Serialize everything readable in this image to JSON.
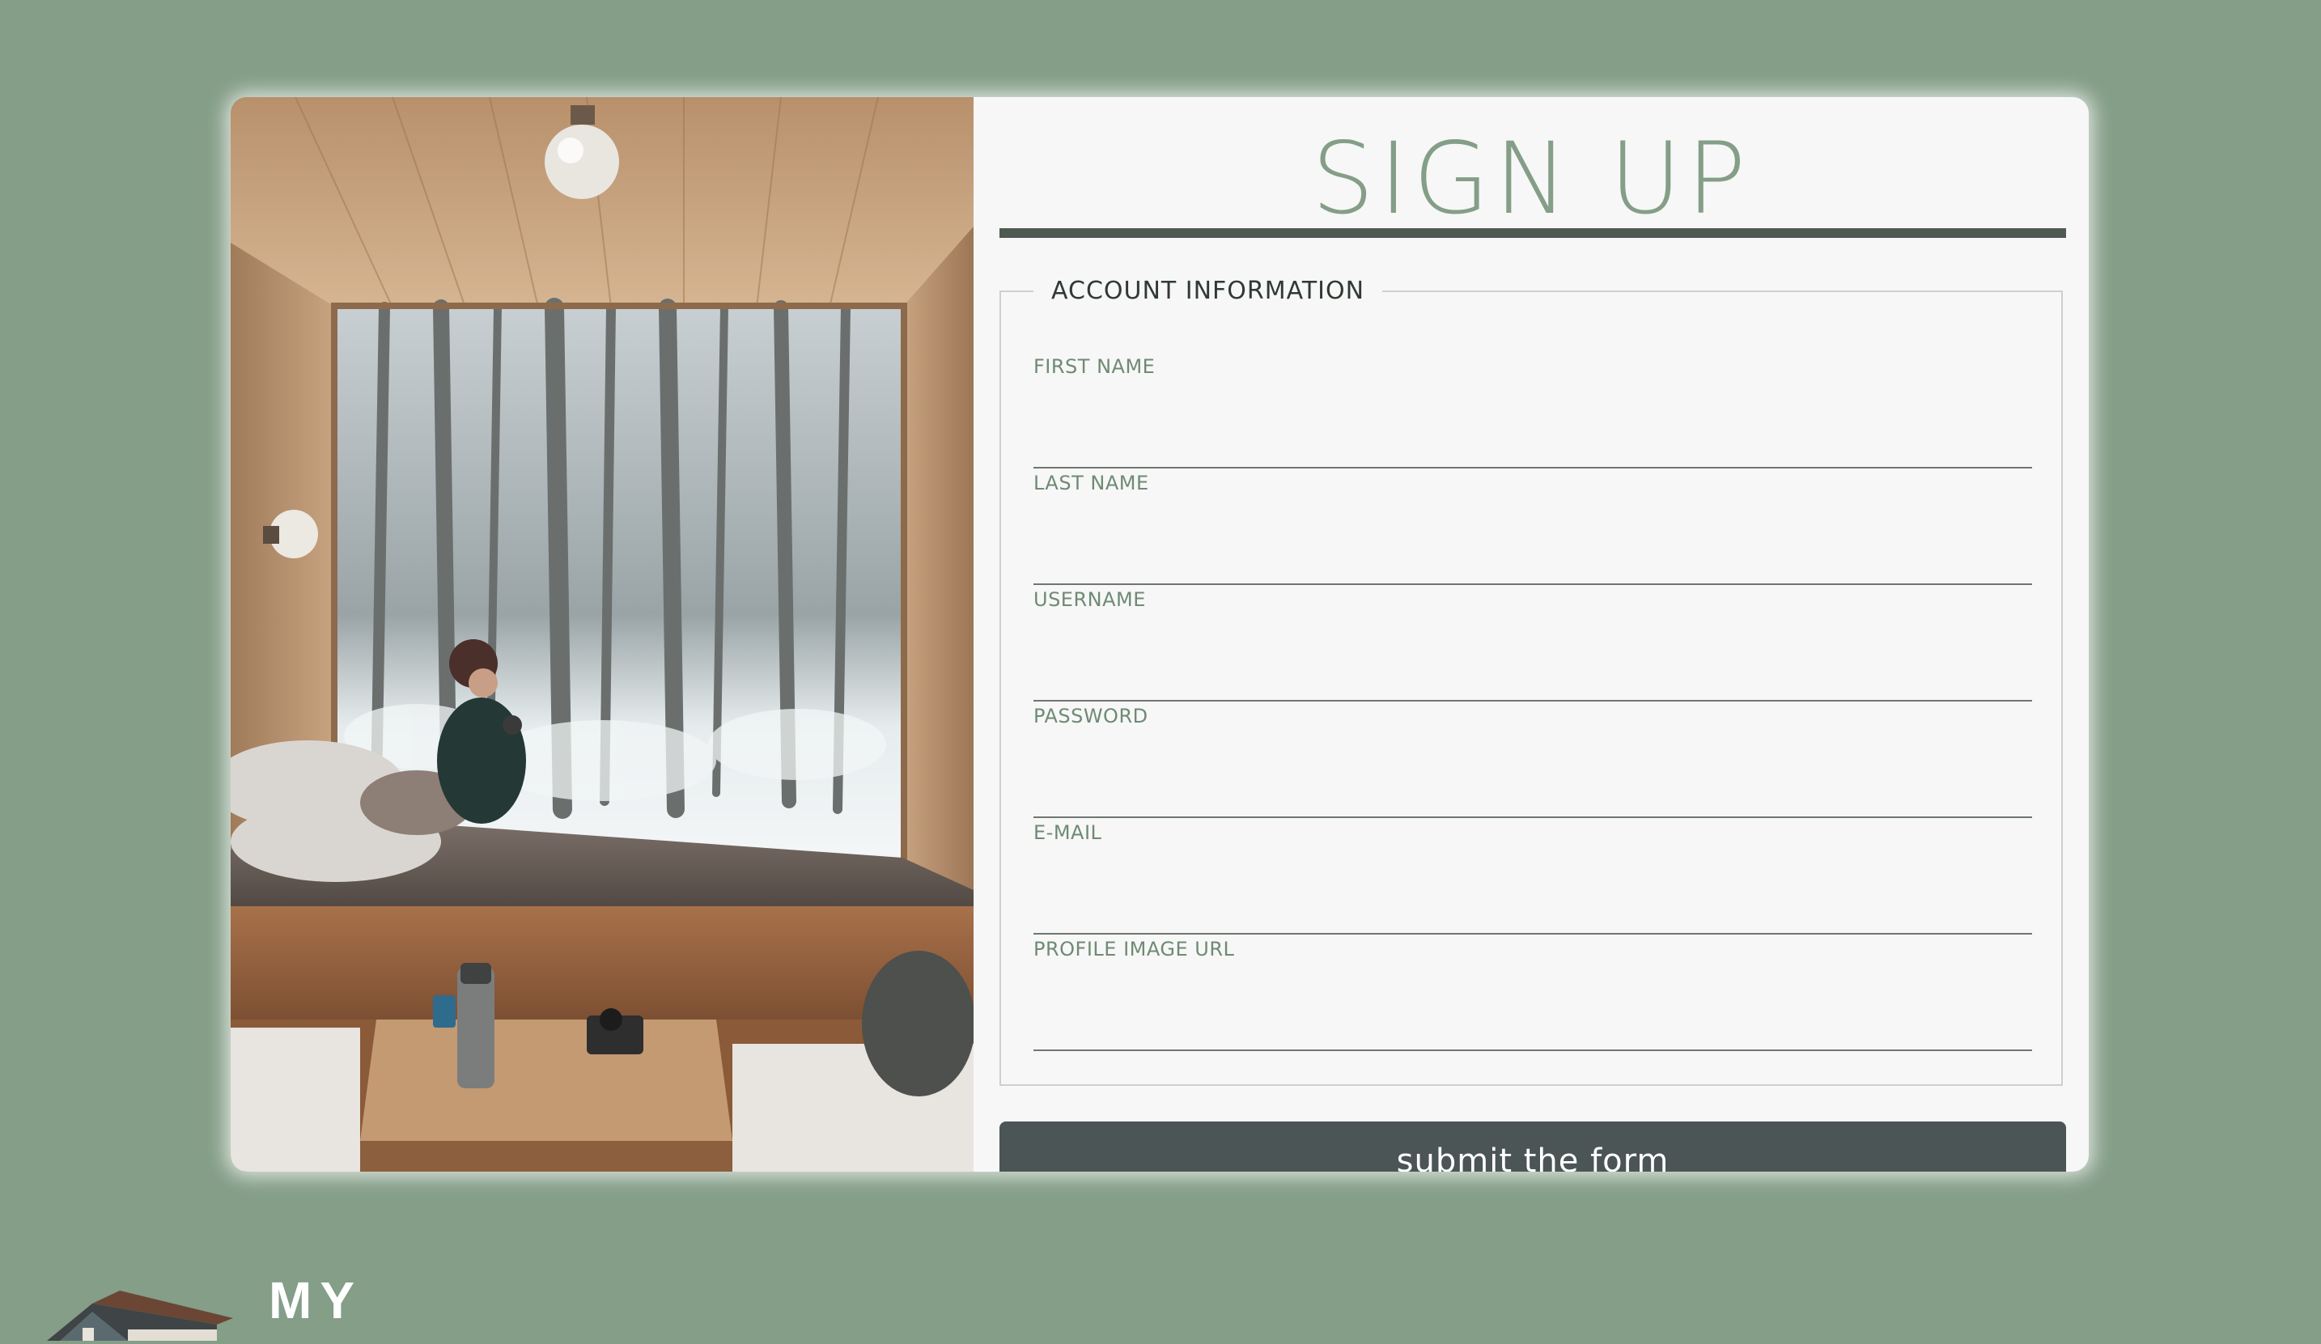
{
  "signup": {
    "title": "SIGN UP",
    "fieldset_legend": "ACCOUNT INFORMATION",
    "fields": [
      {
        "label": "FIRST NAME",
        "value": ""
      },
      {
        "label": "LAST NAME",
        "value": ""
      },
      {
        "label": "USERNAME",
        "value": ""
      },
      {
        "label": "PASSWORD",
        "value": ""
      },
      {
        "label": "E-MAIL",
        "value": ""
      },
      {
        "label": "PROFILE IMAGE URL",
        "value": ""
      }
    ],
    "submit_label": "submit the form"
  },
  "footer": {
    "brand_text": "MY",
    "logo_icon": "house-icon"
  },
  "colors": {
    "background": "#849e88",
    "card": "#f7f7f7",
    "accent_title": "#849e88",
    "rule": "#4f5a52",
    "button": "#4b5556"
  }
}
